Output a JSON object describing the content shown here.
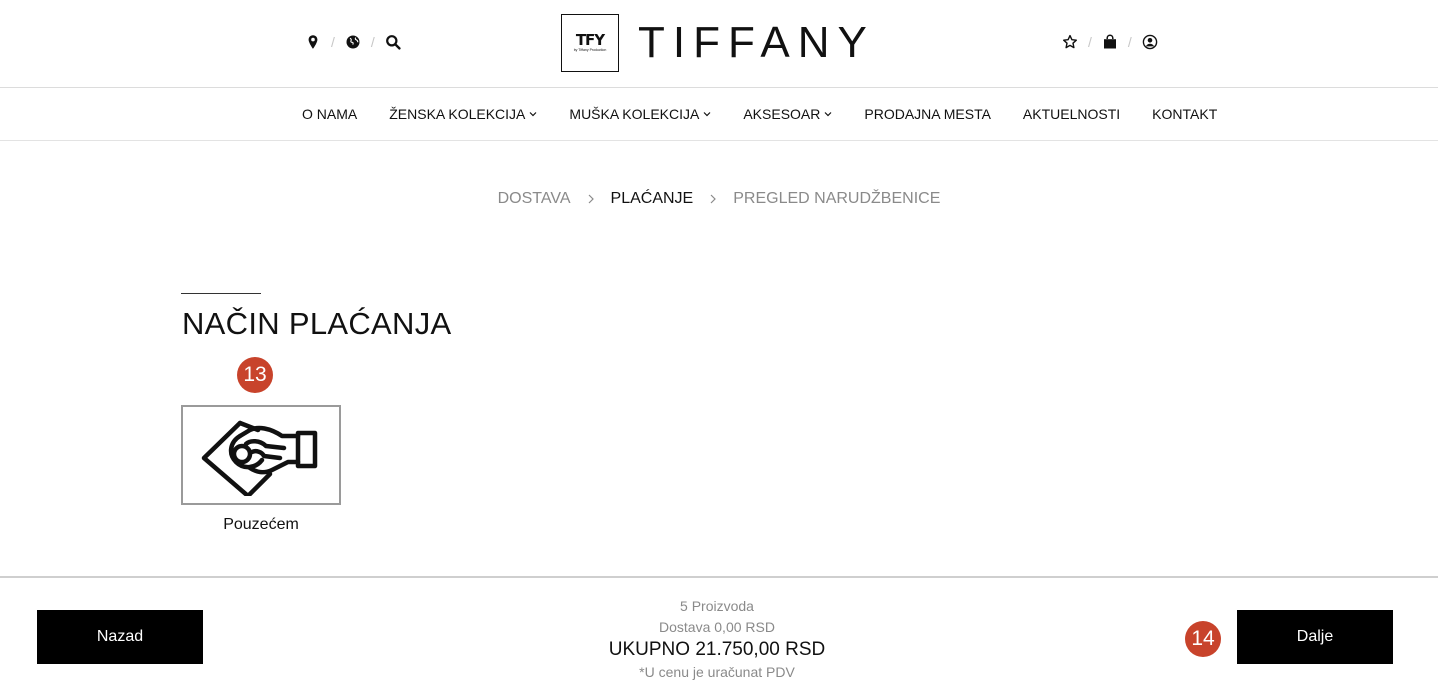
{
  "header": {
    "logo_mark": "TFY",
    "logo_mark_sub": "by Tiffany Production",
    "brand": "TIFFANY",
    "left_icons": [
      "location-icon",
      "globe-icon",
      "search-icon"
    ],
    "right_icons": [
      "star-icon",
      "shopping-bag-icon",
      "user-icon"
    ],
    "separator": "/"
  },
  "nav": {
    "items": [
      {
        "label": "O NAMA",
        "dropdown": false
      },
      {
        "label": "ŽENSKA KOLEKCIJA",
        "dropdown": true
      },
      {
        "label": "MUŠKA KOLEKCIJA",
        "dropdown": true
      },
      {
        "label": "AKSESOAR",
        "dropdown": true
      },
      {
        "label": "PRODAJNA MESTA",
        "dropdown": false
      },
      {
        "label": "AKTUELNOSTI",
        "dropdown": false
      },
      {
        "label": "KONTAKT",
        "dropdown": false
      }
    ]
  },
  "breadcrumb": {
    "steps": [
      {
        "label": "DOSTAVA",
        "active": false
      },
      {
        "label": "PLAĆANJE",
        "active": true
      },
      {
        "label": "PREGLED NARUDŽBENICE",
        "active": false
      }
    ],
    "separator": ">"
  },
  "payment": {
    "title": "NAČIN PLAĆANJA",
    "badge": "13",
    "methods": [
      {
        "label": "Pouzećem",
        "icon": "handshake-money-icon"
      }
    ]
  },
  "footer": {
    "back_label": "Nazad",
    "next_label": "Dalje",
    "next_badge": "14",
    "products": "5 Proizvoda",
    "shipping": "Dostava 0,00 RSD",
    "total": "UKUPNO 21.750,00 RSD",
    "vat_note": "*U cenu je uračunat PDV"
  },
  "colors": {
    "accent_badge": "#c8432b",
    "button_bg": "#000000",
    "muted_text": "#8a8a8a"
  }
}
